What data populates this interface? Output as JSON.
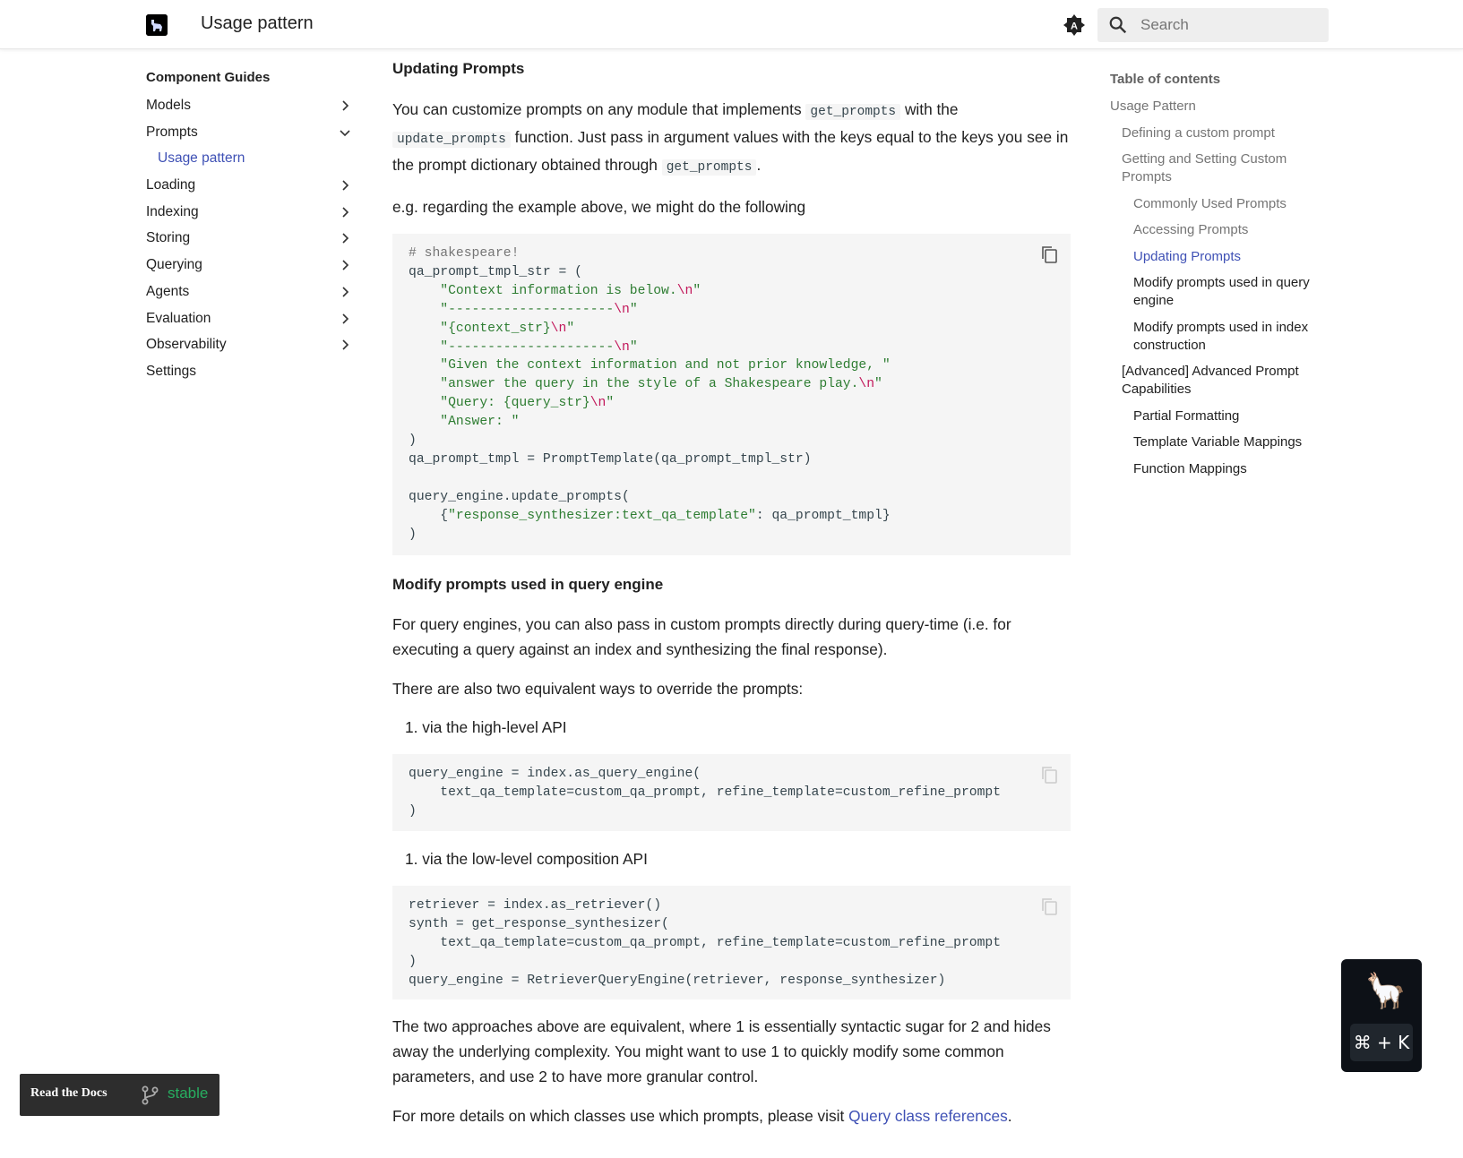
{
  "header": {
    "title": "Usage pattern",
    "search_placeholder": "Search"
  },
  "leftnav": {
    "section": "Component Guides",
    "items": [
      {
        "label": "Models"
      },
      {
        "label": "Prompts"
      },
      {
        "label": "Usage pattern"
      },
      {
        "label": "Loading"
      },
      {
        "label": "Indexing"
      },
      {
        "label": "Storing"
      },
      {
        "label": "Querying"
      },
      {
        "label": "Agents"
      },
      {
        "label": "Evaluation"
      },
      {
        "label": "Observability"
      },
      {
        "label": "Settings"
      }
    ]
  },
  "main": {
    "h_updating": "Updating Prompts",
    "p1_a": "You can customize prompts on any module that implements",
    "p1_code1": "get_prompts",
    "p1_b": "with the",
    "p1_code2": "update_prompts",
    "p1_c": "function. Just pass in argument values with the keys equal to the keys you see in the prompt dictionary obtained through",
    "p1_code3": "get_prompts",
    "p1_d": ".",
    "p2": "e.g. regarding the example above, we might do the following",
    "code1": {
      "l1": "# shakespeare!",
      "l2": "qa_prompt_tmpl_str = (",
      "l3": "\"Context information is below.",
      "l4": "\"---------------------",
      "l5": "\"{context_str}",
      "l6": "\"---------------------",
      "l7": "\"Given the context information and not prior knowledge, \"",
      "l8": "\"answer the query in the style of a Shakespeare play.",
      "l9": "\"Query: {query_str}",
      "l10": "\"Answer: \"",
      "l11": ")",
      "l12": "qa_prompt_tmpl = PromptTemplate(qa_prompt_tmpl_str)",
      "l13": "query_engine.update_prompts(",
      "l14a": "{",
      "l14b": "\"response_synthesizer:text_qa_template\"",
      "l14c": ": qa_prompt_tmpl}",
      "l15": ")",
      "esc": "\\n",
      "q": "\""
    },
    "h_modify": "Modify prompts used in query engine",
    "p3": "For query engines, you can also pass in custom prompts directly during query-time (i.e. for executing a query against an index and synthesizing the final response).",
    "p4": "There are also two equivalent ways to override the prompts:",
    "step1": "1. via the high-level API",
    "code2": {
      "l1": "query_engine = index.as_query_engine(",
      "l2": "    text_qa_template=custom_qa_prompt, refine_template=custom_refine_prompt",
      "l3": ")"
    },
    "step2": "1. via the low-level composition API",
    "code3": {
      "l1": "retriever = index.as_retriever()",
      "l2": "synth = get_response_synthesizer(",
      "l3": "    text_qa_template=custom_qa_prompt, refine_template=custom_refine_prompt",
      "l4": ")",
      "l5": "query_engine = RetrieverQueryEngine(retriever, response_synthesizer)"
    },
    "p5": "The two approaches above are equivalent, where 1 is essentially syntactic sugar for 2 and hides away the underlying complexity. You might want to use 1 to quickly modify some common parameters, and use 2 to have more granular control.",
    "p6_a": "For more details on which classes use which prompts, please visit",
    "p6_link": "Query class references",
    "p6_b": "."
  },
  "toc": {
    "title": "Table of contents",
    "items": [
      {
        "label": "Usage Pattern"
      },
      {
        "label": "Defining a custom prompt"
      },
      {
        "label": "Getting and Setting Custom Prompts"
      },
      {
        "label": "Commonly Used Prompts"
      },
      {
        "label": "Accessing Prompts"
      },
      {
        "label": "Updating Prompts"
      },
      {
        "label": "Modify prompts used in query engine"
      },
      {
        "label": "Modify prompts used in index construction"
      },
      {
        "label": "[Advanced] Advanced Prompt Capabilities"
      },
      {
        "label": "Partial Formatting"
      },
      {
        "label": "Template Variable Mappings"
      },
      {
        "label": "Function Mappings"
      }
    ]
  },
  "widgets": {
    "rtd_logo_text": "Read the Docs",
    "rtd_version": "stable",
    "ai_shortcut": "⌘ + K",
    "ai_emoji": "🦙"
  },
  "colors": {
    "accent": "#3f51b5",
    "code_string": "#2e7d32",
    "code_escape": "#c2185b",
    "rtd_version": "#27ae60"
  }
}
